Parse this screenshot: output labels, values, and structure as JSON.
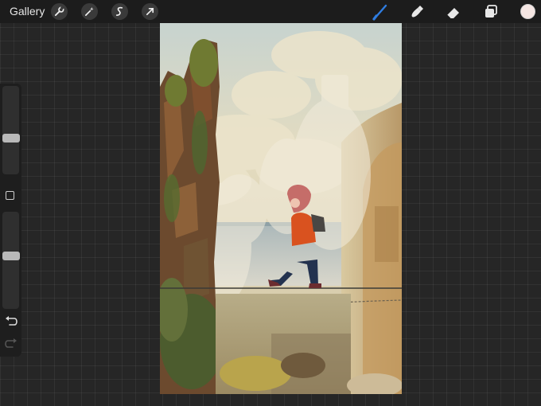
{
  "toolbar": {
    "gallery_label": "Gallery",
    "left_tools": [
      "wrench-icon",
      "magic-wand-icon",
      "selection-icon",
      "transform-arrow-icon"
    ],
    "right_tools": [
      "brush-icon",
      "smudge-icon",
      "eraser-icon",
      "layers-icon"
    ],
    "active_tool": "brush-icon",
    "accent_color": "#2f7de1",
    "current_color": "#f5e6e3"
  },
  "sidebar": {
    "brush_size": 0.4,
    "opacity": 0.55
  },
  "canvas": {
    "artwork": "painting-girl-walking-on-tightrope"
  }
}
